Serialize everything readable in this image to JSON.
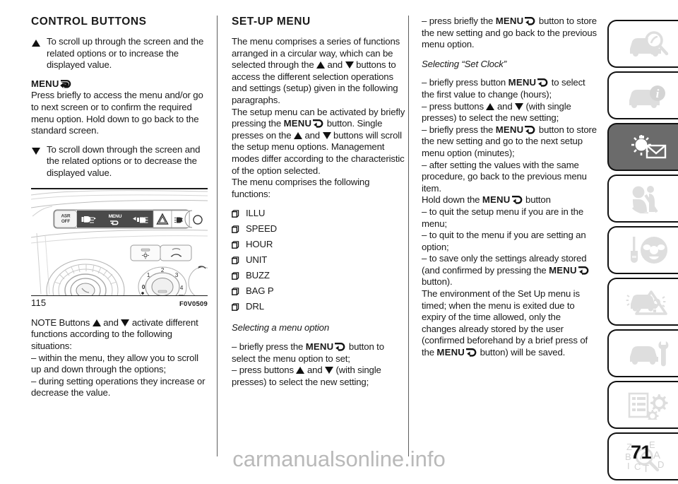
{
  "page": {
    "number": "71",
    "watermark": "carmanualsonline.info"
  },
  "column1": {
    "title": "CONTROL BUTTONS",
    "scroll_up_text": "To scroll up through the screen and the related options or to increase the displayed value.",
    "menu_label": "MENU",
    "menu_paragraph": "Press briefly to access the menu and/or go to next screen or to confirm the required menu option. Hold down to go back to the standard screen.",
    "scroll_down_text": "To scroll down through the screen and the related options or to decrease the displayed value.",
    "figure": {
      "number": "115",
      "code": "F0V0509",
      "button_labels": [
        "ASR OFF",
        "MENU"
      ],
      "dial_numbers": [
        "0",
        "1",
        "2",
        "3",
        "4"
      ]
    },
    "note_part1": "NOTE Buttons",
    "note_and": "and",
    "note_part2": "activate different functions according to the following situations:",
    "note_bullet1": "– within the menu, they allow you to scroll up and down through the options;",
    "note_bullet2": "– during setting operations they increase or decrease the value."
  },
  "column2": {
    "title": "SET-UP MENU",
    "para1_a": "The menu comprises a series of functions arranged in a circular way, which can be selected through the",
    "para1_and": "and",
    "para1_b": "buttons to access the different selection operations and settings (setup) given in the following paragraphs.",
    "para2_a": "The setup menu can be activated by briefly pressing the",
    "menu_label": "MENU",
    "para2_b": "button. Single presses on the",
    "para2_and": "and",
    "para2_c": "buttons will scroll the setup menu options. Management modes differ according to the characteristic of the option selected.",
    "para3": "The menu comprises the following functions:",
    "functions": [
      "ILLU",
      "SPEED",
      "HOUR",
      "UNIT",
      "BUZZ",
      "BAG P",
      "DRL"
    ],
    "subhead": "Selecting a menu option",
    "bullet1_a": "– briefly press the",
    "bullet1_b": "button to select the menu option to set;",
    "bullet2_a": "– press buttons",
    "bullet2_and": "and",
    "bullet2_b": "(with single presses) to select the new setting;"
  },
  "column3": {
    "menu_label": "MENU",
    "bullet1_a": "– press briefly the",
    "bullet1_b": "button to store the new setting and go back to the previous menu option.",
    "subhead": "Selecting “Set Clock”",
    "bullet2_a": "– briefly press button",
    "bullet2_b": "to select the first value to change (hours);",
    "bullet3_a": "– press buttons",
    "bullet3_and": "and",
    "bullet3_b": "(with single presses) to select the new setting;",
    "bullet4_a": "– briefly press the",
    "bullet4_b": "button to store the new setting and go to the next setup menu option (minutes);",
    "bullet5": "– after setting the values with the same procedure, go back to the previous menu item.",
    "hold_a": "Hold down the",
    "hold_b": "button",
    "bullet6": "– to quit the setup menu if you are in the menu;",
    "bullet7": "– to quit to the menu if you are setting an option;",
    "bullet8_a": "– to save only the settings already stored (and confirmed by pressing the",
    "bullet8_b": "button).",
    "para_end_a": "The environment of the Set Up menu is timed; when the menu is exited due to expiry of the time allowed, only the changes already stored by the user (confirmed beforehand by a brief press of the",
    "para_end_b": "button) will be saved."
  },
  "tabs": [
    {
      "name": "car-inspection",
      "icon": "car-magnifier-icon",
      "active": false
    },
    {
      "name": "dashboard-info",
      "icon": "car-info-icon",
      "active": false
    },
    {
      "name": "lights-and-messages",
      "icon": "sun-envelope-icon",
      "active": true
    },
    {
      "name": "safety-seatbelt",
      "icon": "seatbelt-person-icon",
      "active": false
    },
    {
      "name": "starting-and-driving",
      "icon": "key-steering-wheel-icon",
      "active": false
    },
    {
      "name": "emergency",
      "icon": "car-warning-triangle-icon",
      "active": false
    },
    {
      "name": "maintenance",
      "icon": "car-wrench-icon",
      "active": false
    },
    {
      "name": "technical-specifications",
      "icon": "list-gears-icon",
      "active": false
    },
    {
      "name": "alphabetical-index",
      "icon": "index-magnifier-icon",
      "active": false,
      "letters": [
        "Z",
        "E",
        "B",
        "A",
        "I",
        "C",
        "T",
        "D"
      ]
    }
  ],
  "colors": {
    "active_tab_bg": "#6b6b6b",
    "tab_border": "#111111",
    "icon_gray": "#dedede",
    "rule": "#1a1a1a",
    "watermark": "#b9b9b9"
  }
}
